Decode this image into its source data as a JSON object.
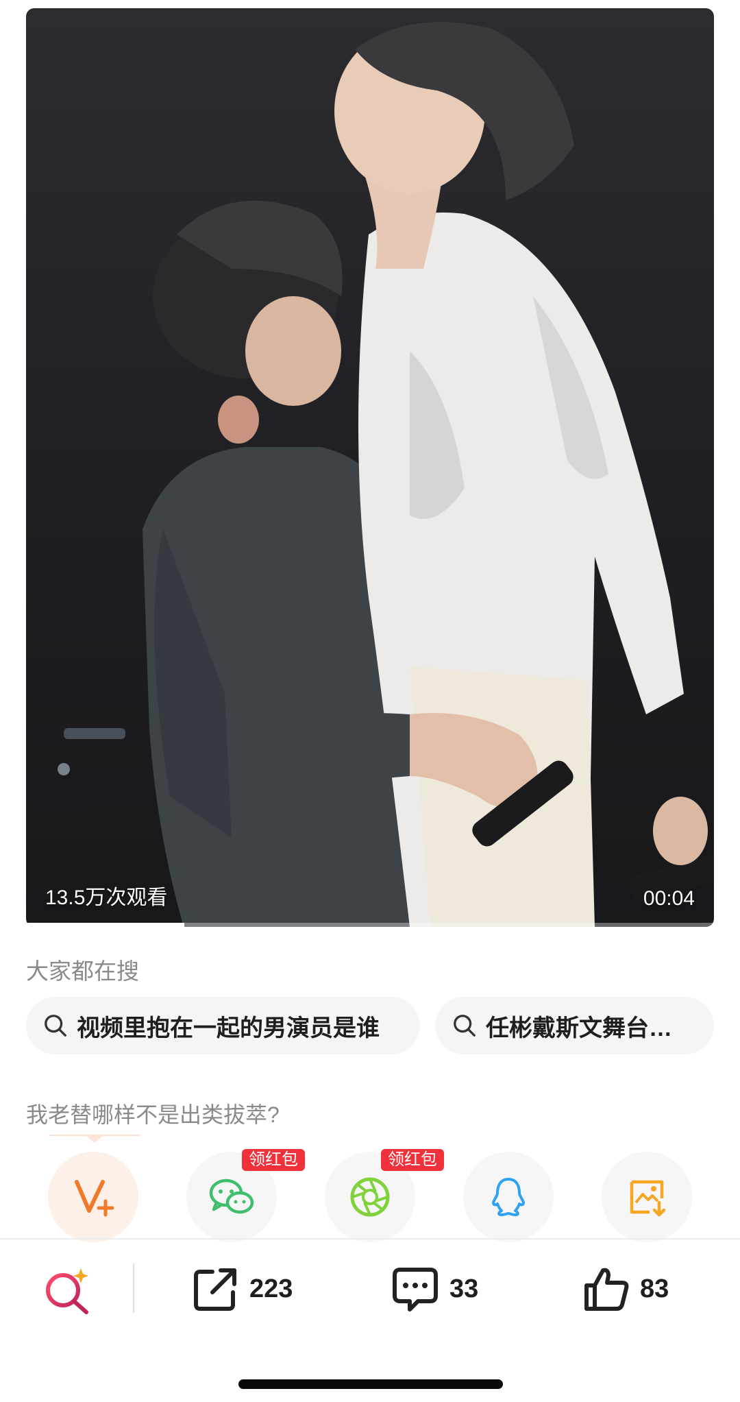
{
  "video": {
    "view_count": "13.5万次观看",
    "duration": "00:04",
    "progress": 0.23
  },
  "everyone_searching": {
    "label": "大家都在搜",
    "items": [
      "视频里抱在一起的男演员是谁",
      "任彬戴斯文舞台…"
    ]
  },
  "prompt": "我老替哪样不是出类拔萃?",
  "share": {
    "targets": [
      {
        "icon": "v-plus-icon"
      },
      {
        "icon": "wechat-icon",
        "badge": "领红包"
      },
      {
        "icon": "moments-icon",
        "badge": "领红包"
      },
      {
        "icon": "qq-icon"
      },
      {
        "icon": "save-image-icon"
      }
    ]
  },
  "bottom_bar": {
    "shares": "223",
    "comments": "33",
    "likes": "83"
  },
  "colors": {
    "badge": "#f0303a",
    "wechat": "#3fbf6e",
    "moments": "#7ed23a",
    "qq": "#2da1f2",
    "save": "#f5a623",
    "vplus": "#f07a2a"
  }
}
